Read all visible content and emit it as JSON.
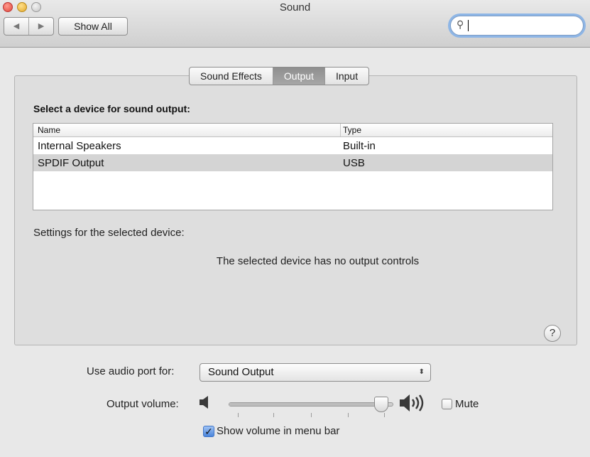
{
  "window": {
    "title": "Sound"
  },
  "toolbar": {
    "back_glyph": "◀",
    "forward_glyph": "▶",
    "show_all_label": "Show All",
    "search_value": ""
  },
  "tabs": [
    {
      "label": "Sound Effects",
      "active": false
    },
    {
      "label": "Output",
      "active": true
    },
    {
      "label": "Input",
      "active": false
    }
  ],
  "output": {
    "heading": "Select a device for sound output:",
    "columns": {
      "name": "Name",
      "type": "Type"
    },
    "devices": [
      {
        "name": "Internal Speakers",
        "type": "Built-in",
        "selected": false
      },
      {
        "name": "SPDIF Output",
        "type": "USB",
        "selected": true
      }
    ],
    "settings_label": "Settings for the selected device:",
    "no_controls_message": "The selected device has no output controls",
    "help_glyph": "?"
  },
  "footer": {
    "audio_port_label": "Use audio port for:",
    "audio_port_value": "Sound Output",
    "select_arrows": "⬍",
    "output_volume_label": "Output volume:",
    "volume_fraction": 0.96,
    "mute_label": "Mute",
    "mute_checked": false,
    "show_volume_label": "Show volume in menu bar",
    "show_volume_checked": true,
    "check_glyph": "✓"
  },
  "colors": {
    "focus_ring": "#8eb6e6",
    "selected_row": "#d4d4d4",
    "active_tab": "#9a9a9a",
    "checkbox_checked": "#4b85db"
  }
}
